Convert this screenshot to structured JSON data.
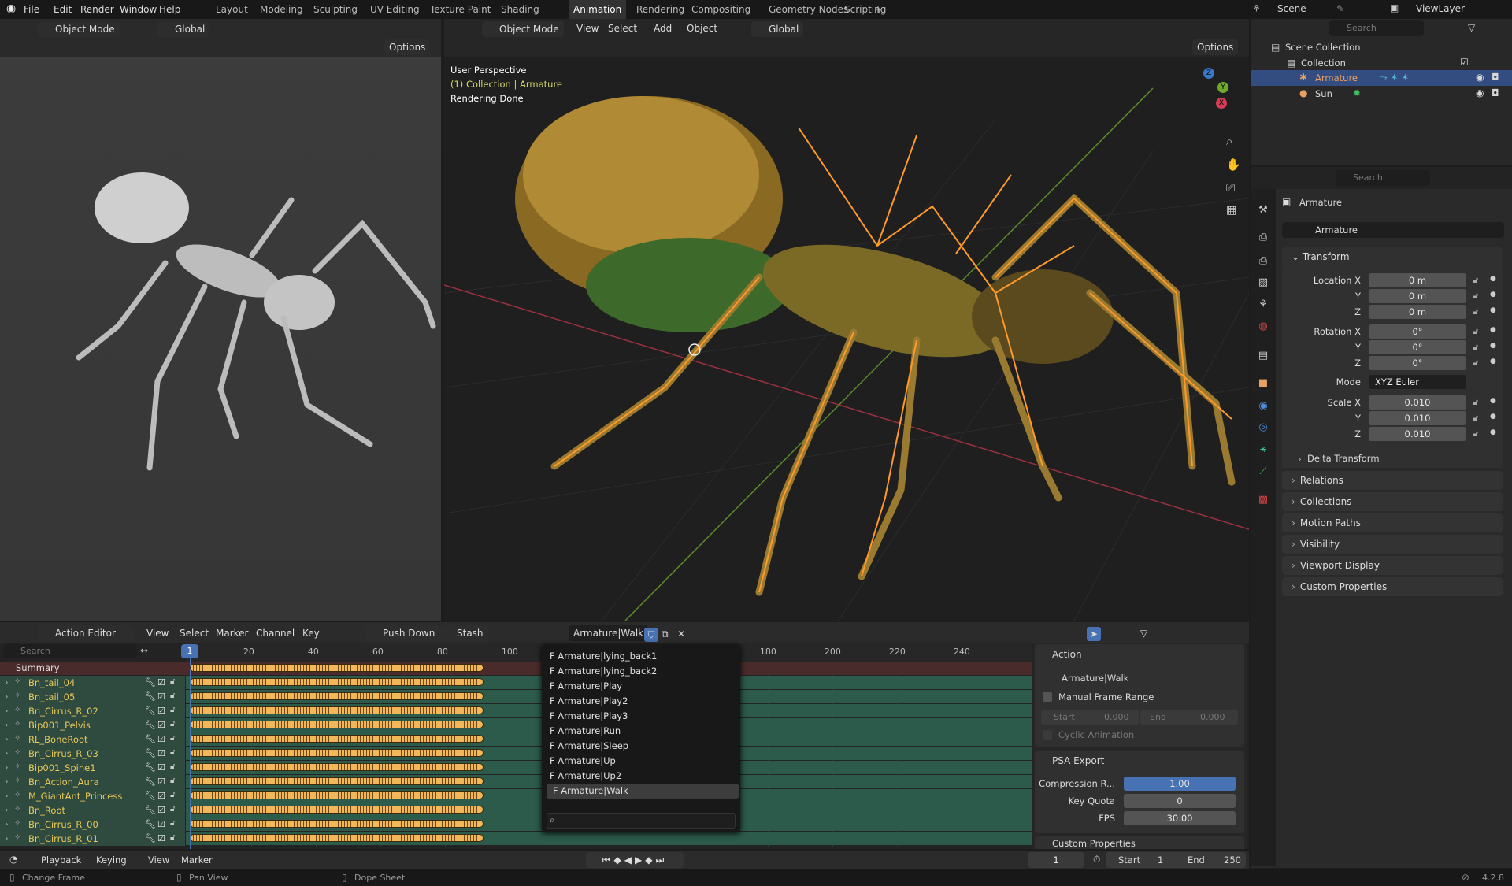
{
  "topbar": {
    "menus": [
      "File",
      "Edit",
      "Render",
      "Window",
      "Help"
    ],
    "workspaces": [
      "Layout",
      "Modeling",
      "Sculpting",
      "UV Editing",
      "Texture Paint",
      "Shading",
      "Animation",
      "Rendering",
      "Compositing",
      "Geometry Nodes",
      "Scripting"
    ],
    "active_workspace": "Animation",
    "add": "+",
    "scene": "Scene",
    "view_layer": "ViewLayer"
  },
  "left_viewport": {
    "mode": "Object Mode",
    "orientation": "Global",
    "options": "Options"
  },
  "main_viewport": {
    "mode": "Object Mode",
    "menus": [
      "View",
      "Select",
      "Add",
      "Object"
    ],
    "orientation": "Global",
    "options": "Options",
    "overlay": {
      "perspective": "User Perspective",
      "collection": "(1) Collection | Armature",
      "status": "Rendering Done"
    },
    "gizmo": {
      "x": "X",
      "y": "Y",
      "z": "Z"
    }
  },
  "outliner": {
    "search_placeholder": "Search",
    "scene_collection": "Scene Collection",
    "collection": "Collection",
    "items": [
      {
        "name": "Armature",
        "selected": true
      },
      {
        "name": "Sun",
        "selected": false
      }
    ]
  },
  "properties": {
    "search_placeholder": "Search",
    "object_name": "Armature",
    "datablock": "Armature",
    "transform": {
      "title": "Transform",
      "location": {
        "label": "Location X",
        "x": "0 m",
        "y": "0 m",
        "z": "0 m"
      },
      "rotation": {
        "label": "Rotation X",
        "x": "0°",
        "y": "0°",
        "z": "0°"
      },
      "mode_label": "Mode",
      "mode": "XYZ Euler",
      "scale": {
        "label": "Scale X",
        "x": "0.010",
        "y": "0.010",
        "z": "0.010"
      },
      "axis_y": "Y",
      "axis_z": "Z",
      "delta": "Delta Transform"
    },
    "panels": [
      "Relations",
      "Collections",
      "Motion Paths",
      "Visibility",
      "Viewport Display",
      "Custom Properties"
    ]
  },
  "dopesheet": {
    "editor": "Action Editor",
    "menus": [
      "View",
      "Select",
      "Marker",
      "Channel",
      "Key"
    ],
    "push_down": "Push Down",
    "stash": "Stash",
    "action": "Armature|Walk",
    "search_placeholder": "Search",
    "current_frame": "1",
    "ruler": [
      20,
      40,
      60,
      80,
      100,
      180,
      200,
      220,
      240
    ],
    "key_range": [
      1,
      92
    ],
    "summary": "Summary",
    "channels": [
      "Bn_tail_04",
      "Bn_tail_05",
      "Bn_Cirrus_R_02",
      "Bip001_Pelvis",
      "RL_BoneRoot",
      "Bn_Cirrus_R_03",
      "Bip001_Spine1",
      "Bn_Action_Aura",
      "M_GiantAnt_Princess",
      "Bn_Root",
      "Bn_Cirrus_R_00",
      "Bn_Cirrus_R_01"
    ],
    "action_list": [
      "F Armature|lying_back1",
      "F Armature|lying_back2",
      "F Armature|Play",
      "F Armature|Play2",
      "F Armature|Play3",
      "F Armature|Run",
      "F Armature|Sleep",
      "F Armature|Up",
      "F Armature|Up2",
      "F Armature|Walk"
    ],
    "sidebar": {
      "action_title": "Action",
      "action_name": "Armature|Walk",
      "manual_range": "Manual Frame Range",
      "start_label": "Start",
      "start": "0.000",
      "end_label": "End",
      "end": "0.000",
      "cyclic": "Cyclic Animation",
      "psa_title": "PSA Export",
      "compression_label": "Compression R...",
      "compression": "1.00",
      "key_quota_label": "Key Quota",
      "key_quota": "0",
      "fps_label": "FPS",
      "fps": "30.00",
      "custom": "Custom Properties"
    }
  },
  "timeline": {
    "menus": [
      "Playback",
      "Keying",
      "View",
      "Marker"
    ],
    "frame": "1",
    "start_label": "Start",
    "start": "1",
    "end_label": "End",
    "end": "250"
  },
  "statusbar": {
    "change_frame": "Change Frame",
    "pan_view": "Pan View",
    "dope_sheet": "Dope Sheet",
    "version": "4.2.8"
  },
  "colors": {
    "accent": "#4772b3",
    "selected_row": "#334d80",
    "armature_text": "#e8a064",
    "channel_text": "#e8c95a",
    "keyframe": "#f2b75a"
  }
}
